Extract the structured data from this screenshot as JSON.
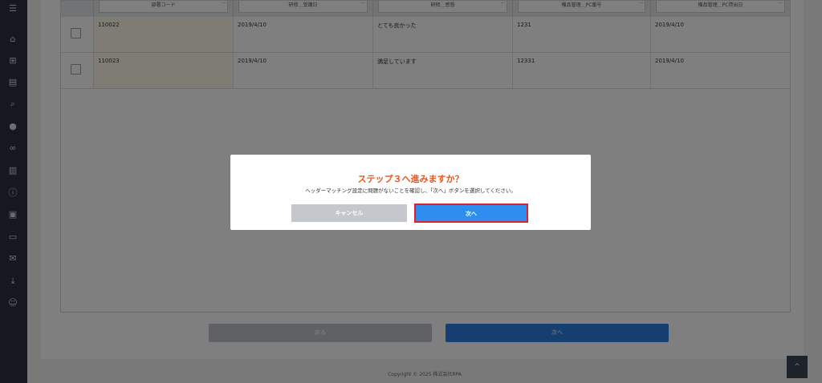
{
  "table": {
    "headers": [
      "部署コード",
      "研修＿受講日",
      "研修＿感想",
      "備品管理＿PC番号",
      "備品管理＿PC貸出日"
    ],
    "rows": [
      [
        "110022",
        "2019/4/10",
        "とても良かった",
        "1231",
        "2019/4/10"
      ],
      [
        "110023",
        "2019/4/10",
        "満足しています",
        "12331",
        "2019/4/10"
      ]
    ]
  },
  "nav": {
    "back_label": "戻る",
    "next_label": "次へ"
  },
  "footer": {
    "copyright": "Copyright © 2025 株式会社RPA"
  },
  "modal": {
    "title": "ステップ３へ進みますか？",
    "message": "ヘッダーマッチング設定に問題がないことを確認し、「次へ」ボタンを選択してください。",
    "cancel_label": "キャンセル",
    "next_label": "次へ"
  },
  "colors": {
    "accent": "#2d8ef0",
    "title": "#e8571e",
    "highlight_border": "#e0212b",
    "sidebar": "#2a3140"
  }
}
